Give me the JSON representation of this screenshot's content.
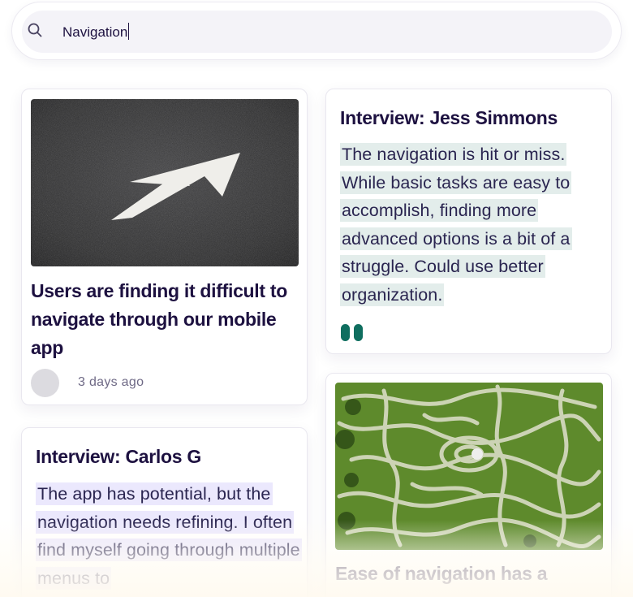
{
  "search": {
    "value": "Navigation"
  },
  "cards": [
    {
      "type": "highlight",
      "image": "arrow-on-asphalt",
      "title": "Users are finding it difficult to navigate through our mobile app",
      "time": "3 days ago"
    },
    {
      "type": "interview",
      "title": "Interview: Jess Simmons",
      "quote": "The navigation is hit or miss. While basic tasks are easy to accomplish, finding more advanced options is a bit of a struggle. Could use better organization.",
      "quote_icon": "quote-marks-icon",
      "accent": "#0f6e5f"
    },
    {
      "type": "interview",
      "title": "Interview: Carlos G",
      "quote": "The app has potential, but the navigation needs refining. I often find myself going through multiple menus to"
    },
    {
      "type": "highlight",
      "image": "hedge-maze",
      "title": "Ease of navigation has a"
    }
  ],
  "colors": {
    "text": "#1d1140",
    "teal_highlight": "#e3edeb",
    "purple_highlight": "#ebe8fd",
    "accent": "#0f6e5f"
  }
}
